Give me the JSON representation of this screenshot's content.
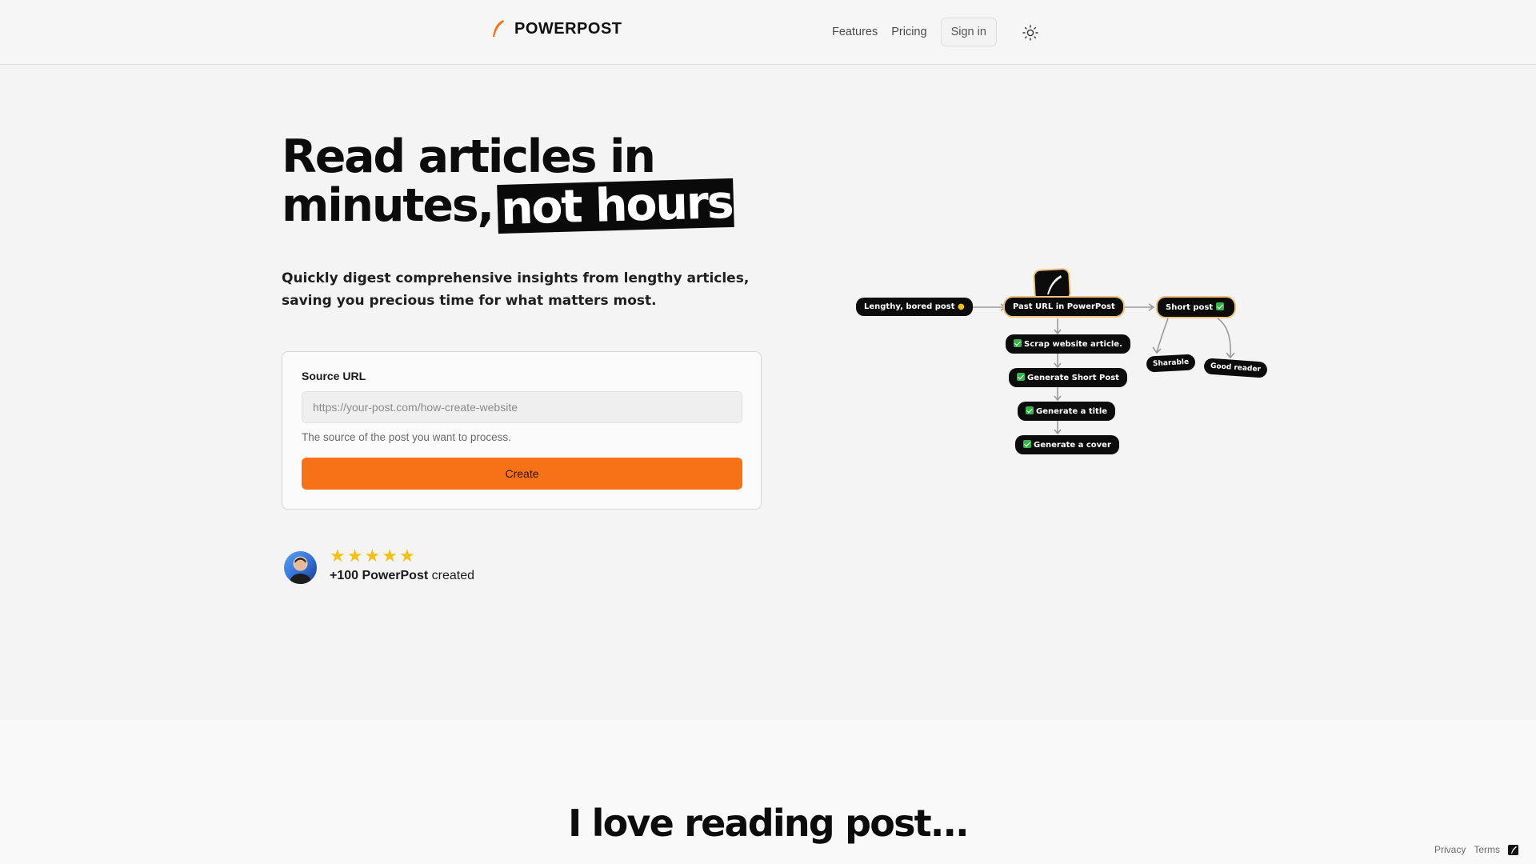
{
  "brand": {
    "name": "POWERPOST",
    "accent": "#f77216"
  },
  "nav": {
    "features": "Features",
    "pricing": "Pricing",
    "signin": "Sign in",
    "theme_icon": "sun-icon"
  },
  "hero": {
    "title_line1": "Read articles in",
    "title_line2": "minutes,",
    "title_highlight": "not hours",
    "subtitle": "Quickly digest comprehensive insights from lengthy articles, saving you precious time for what matters most."
  },
  "form": {
    "label": "Source URL",
    "placeholder": "https://your-post.com/how-create-website",
    "help": "The source of the post you want to process.",
    "submit": "Create"
  },
  "proof": {
    "rating": 5,
    "count": "+100 PowerPost",
    "suffix": " created"
  },
  "diagram": {
    "nodes": {
      "input": "Lengthy, bored post",
      "center": "Past URL in PowerPost",
      "output": "Short post",
      "step1": "Scrap website article.",
      "step2": "Generate Short Post",
      "step3": "Generate a title",
      "step4": "Generate a cover",
      "side1": "Sharable",
      "side2": "Good reader"
    }
  },
  "section2": {
    "title": "I love reading post..."
  },
  "footer": {
    "privacy": "Privacy",
    "terms": "Terms"
  }
}
